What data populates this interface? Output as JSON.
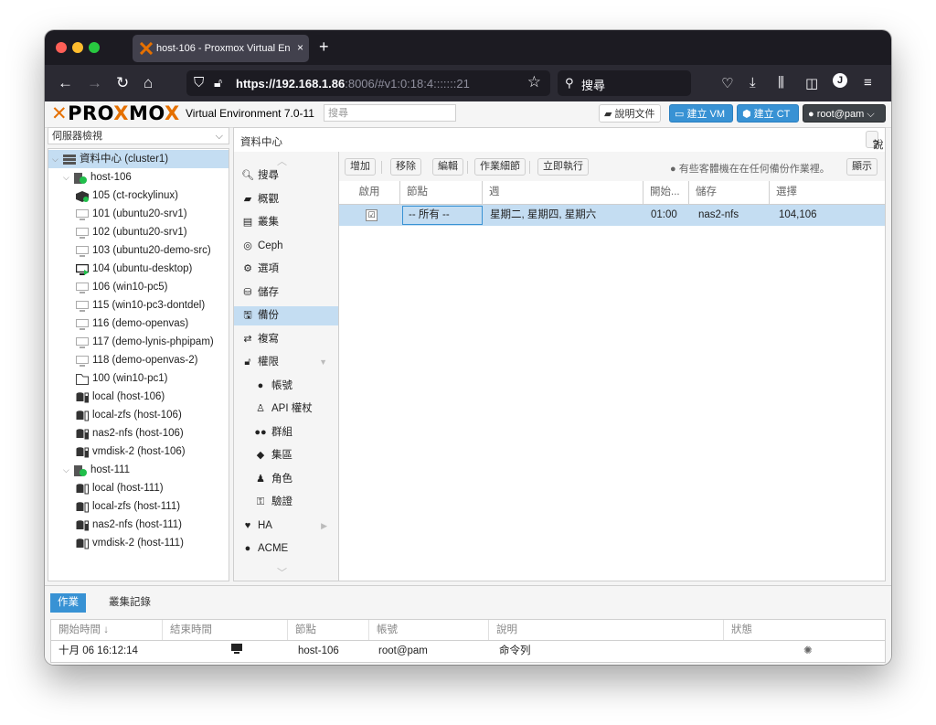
{
  "browser": {
    "tab_title": "host-106 - Proxmox Virtual Envi",
    "tab_close": "×",
    "new_tab": "+",
    "url_host": "https://192.168.1.86",
    "url_rest": ":8006/#v1:0:18:4:::::::21",
    "search_label": "搜尋",
    "icons": [
      "back-icon",
      "forward-icon",
      "reload-icon",
      "home-icon",
      "shield-icon",
      "lock-icon",
      "bookmark-star-icon",
      "search-icon",
      "pocket-icon",
      "download-icon",
      "library-icon",
      "sidebar-icon",
      "account-icon",
      "menu-icon"
    ]
  },
  "pve": {
    "logo_a": "PRO",
    "logo_b": "MO",
    "version": "Virtual Environment 7.0-11",
    "search_placeholder": "搜尋",
    "doc_button": "說明文件",
    "create_vm": "建立 VM",
    "create_ct": "建立 CT",
    "user": "root@pam"
  },
  "view_selector": "伺服器檢視",
  "tree": [
    {
      "label": "資料中心 (cluster1)",
      "icon": "datacenter",
      "indent": 0,
      "toggle": "⌵",
      "selected": true
    },
    {
      "label": "host-106",
      "icon": "node",
      "indent": 1,
      "toggle": "⌵"
    },
    {
      "label": "105 (ct-rockylinux)",
      "icon": "container",
      "indent": 2
    },
    {
      "label": "101 (ubuntu20-srv1)",
      "icon": "vm",
      "indent": 2
    },
    {
      "label": "102 (ubuntu20-srv1)",
      "icon": "vm",
      "indent": 2
    },
    {
      "label": "103 (ubuntu20-demo-src)",
      "icon": "vm",
      "indent": 2
    },
    {
      "label": "104 (ubuntu-desktop)",
      "icon": "vm-running",
      "indent": 2
    },
    {
      "label": "106 (win10-pc5)",
      "icon": "vm",
      "indent": 2
    },
    {
      "label": "115 (win10-pc3-dontdel)",
      "icon": "vm",
      "indent": 2
    },
    {
      "label": "116 (demo-openvas)",
      "icon": "vm",
      "indent": 2
    },
    {
      "label": "117 (demo-lynis-phpipam)",
      "icon": "vm",
      "indent": 2
    },
    {
      "label": "118 (demo-openvas-2)",
      "icon": "vm",
      "indent": 2
    },
    {
      "label": "100 (win10-pc1)",
      "icon": "template",
      "indent": 2
    },
    {
      "label": "local (host-106)",
      "icon": "storage",
      "indent": 2
    },
    {
      "label": "local-zfs (host-106)",
      "icon": "storage-empty",
      "indent": 2
    },
    {
      "label": "nas2-nfs (host-106)",
      "icon": "storage",
      "indent": 2
    },
    {
      "label": "vmdisk-2 (host-106)",
      "icon": "storage",
      "indent": 2
    },
    {
      "label": "host-111",
      "icon": "node",
      "indent": 1,
      "toggle": "⌵"
    },
    {
      "label": "local (host-111)",
      "icon": "storage-empty",
      "indent": 2
    },
    {
      "label": "local-zfs (host-111)",
      "icon": "storage-empty",
      "indent": 2
    },
    {
      "label": "nas2-nfs (host-111)",
      "icon": "storage",
      "indent": 2
    },
    {
      "label": "vmdisk-2 (host-111)",
      "icon": "storage-empty",
      "indent": 2
    }
  ],
  "content_title": "資料中心",
  "help_button": "說明",
  "menu": [
    {
      "label": "搜尋",
      "icon": "search-icon",
      "glyph": "🔍︎"
    },
    {
      "label": "概觀",
      "icon": "book-icon",
      "glyph": "▰"
    },
    {
      "label": "叢集",
      "icon": "server-icon",
      "glyph": "▤"
    },
    {
      "label": "Ceph",
      "icon": "ceph-icon",
      "glyph": "◎"
    },
    {
      "label": "選項",
      "icon": "gear-icon",
      "glyph": "⚙"
    },
    {
      "label": "儲存",
      "icon": "database-icon",
      "glyph": "⛁"
    },
    {
      "label": "備份",
      "icon": "floppy-icon",
      "glyph": "🖫",
      "selected": true
    },
    {
      "label": "複寫",
      "icon": "retweet-icon",
      "glyph": "⇄"
    },
    {
      "label": "權限",
      "icon": "unlock-icon",
      "glyph": "🔓︎",
      "arrow": "▼"
    },
    {
      "label": "帳號",
      "icon": "user-icon",
      "glyph": "●",
      "sub": true
    },
    {
      "label": "API 權杖",
      "icon": "person-outline-icon",
      "glyph": "♙",
      "sub": true
    },
    {
      "label": "群組",
      "icon": "users-icon",
      "glyph": "●●",
      "sub": true
    },
    {
      "label": "集區",
      "icon": "tags-icon",
      "glyph": "◆",
      "sub": true
    },
    {
      "label": "角色",
      "icon": "male-icon",
      "glyph": "♟",
      "sub": true
    },
    {
      "label": "驗證",
      "icon": "key-icon",
      "glyph": "⚿",
      "sub": true
    },
    {
      "label": "HA",
      "icon": "heartbeat-icon",
      "glyph": "♥",
      "arrow": "▶"
    },
    {
      "label": "ACME",
      "icon": "certificate-icon",
      "glyph": "●"
    }
  ],
  "toolbar": {
    "add": "增加",
    "remove": "移除",
    "edit": "編輯",
    "job_detail": "作業細節",
    "run_now": "立即執行",
    "notice": "有些客體機在在任何備份作業裡。",
    "show": "顯示"
  },
  "backup_columns": [
    "啟用",
    "節點",
    "週",
    "開始...",
    "儲存",
    "選擇"
  ],
  "backup_rows": [
    {
      "enabled": "☑",
      "node": "-- 所有 --",
      "days": "星期二, 星期四, 星期六",
      "start": "01:00",
      "storage": "nas2-nfs",
      "selection": "104,106"
    }
  ],
  "bottom_tabs": {
    "tasks": "作業",
    "cluster_log": "叢集記錄"
  },
  "task_columns": [
    "開始時間 ↓",
    "結束時間",
    "節點",
    "帳號",
    "說明",
    "狀態"
  ],
  "task_rows": [
    {
      "start": "十月 06 16:12:14",
      "end": "",
      "node": "host-106",
      "user": "root@pam",
      "desc": "命令列",
      "status": "running"
    }
  ],
  "colors": {
    "accent": "#3892d4",
    "selection": "#c4ddf2",
    "brand_orange": "#e57000"
  }
}
